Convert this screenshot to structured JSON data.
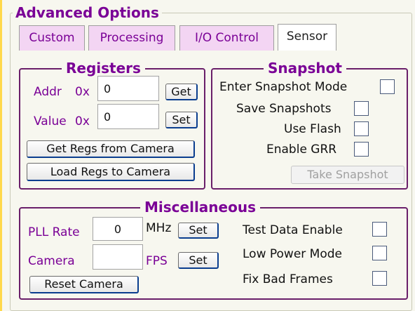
{
  "advanced_options": {
    "title": "Advanced Options"
  },
  "tabs": [
    {
      "label": "Custom"
    },
    {
      "label": "Processing"
    },
    {
      "label": "I/O Control"
    },
    {
      "label": "Sensor"
    }
  ],
  "registers": {
    "title": "Registers",
    "addr_label": "Addr",
    "addr_prefix": "0x",
    "addr_value": "0",
    "get_label": "Get",
    "value_label": "Value",
    "value_prefix": "0x",
    "value_value": "0",
    "set_label": "Set",
    "get_regs_label": "Get Regs from Camera",
    "load_regs_label": "Load Regs to Camera"
  },
  "snapshot": {
    "title": "Snapshot",
    "enter_mode_label": "Enter Snapshot Mode",
    "save_label": "Save Snapshots",
    "use_flash_label": "Use Flash",
    "enable_grr_label": "Enable GRR",
    "take_snapshot_label": "Take Snapshot"
  },
  "misc": {
    "title": "Miscellaneous",
    "pll_label": "PLL Rate",
    "pll_value": "0",
    "pll_unit": "MHz",
    "pll_set_label": "Set",
    "camera_label": "Camera",
    "camera_value": "",
    "camera_unit": "FPS",
    "camera_set_label": "Set",
    "reset_label": "Reset Camera",
    "test_data_label": "Test Data Enable",
    "low_power_label": "Low Power Mode",
    "fix_bad_frames_label": "Fix Bad Frames"
  }
}
